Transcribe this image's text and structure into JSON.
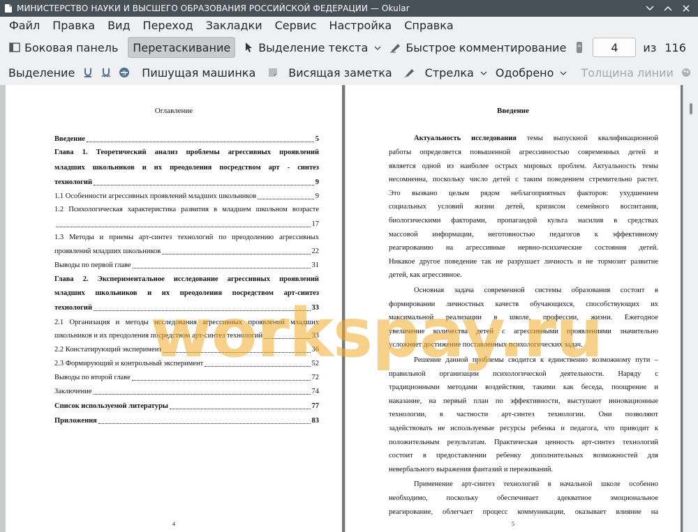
{
  "window": {
    "title": "МИНИСТЕРСТВО НАУКИ И ВЫСШЕГО ОБРАЗОВАНИЯ РОССИЙСКОЙ ФЕДЕРАЦИИ  — Okular",
    "controls": [
      "chevron-down-icon",
      "chevron-up-icon",
      "close-icon"
    ]
  },
  "menu": [
    "Файл",
    "Правка",
    "Вид",
    "Переход",
    "Закладки",
    "Сервис",
    "Настройка",
    "Справка"
  ],
  "toolbar1": {
    "sidebar": "Боковая панель",
    "drag": "Перетаскивание",
    "text_select": "Выделение текста",
    "quick_comment": "Быстрое комментирование",
    "page_value": "4",
    "of_label": "из",
    "total_pages": "116"
  },
  "toolbar2": {
    "highlight": "Выделение",
    "typewriter": "Пишущая машинка",
    "note": "Висящая заметка",
    "arrow": "Стрелка",
    "approved": "Одобрено",
    "line_width": "Толщина линии"
  },
  "left_page": {
    "heading": "Оглавление",
    "page_number": "4",
    "toc": [
      {
        "text": "Введение",
        "page": "5"
      },
      {
        "line1": "Глава 1. Теоретический анализ проблемы агрессивных проявлений",
        "line2": "младших школьников и их преодоления посредством арт - синтез",
        "text": "технологий",
        "page": "9"
      },
      {
        "text": "1.1 Особенности агрессивных проявлений младших школьников",
        "page": "9"
      },
      {
        "line1": "1.2 Психологическая характеристика развития в младшем школьном возрасте",
        "text": "",
        "page": "17"
      },
      {
        "line1": "1.3 Методы и приемы арт-синтез технологий  по преодолению агрессивных",
        "text": "проявлений младших школьников",
        "page": "22"
      },
      {
        "text": "Выводы по первой главе",
        "page": "31"
      },
      {
        "line1": "Глава 2. Экспериментальное исследование агрессивных проявлений",
        "line2": "младших школьников и их преодоления посредством арт-синтез",
        "text": "технологий",
        "page": "33"
      },
      {
        "line1": "2.1 Организация и методы исследования агрессивных проявлений младших",
        "text": "школьников и их преодоления посредством арт-синтез технологий",
        "page": "33"
      },
      {
        "text": "2.2 Констатирующий эксперимент",
        "page": "36"
      },
      {
        "text": "2.3 Формирующий и контрольный эксперимент",
        "page": "52"
      },
      {
        "text": "Выводы по второй главе",
        "page": "72"
      },
      {
        "text": "Заключение",
        "page": "74"
      },
      {
        "text": "Список используемой литературы",
        "page": "77"
      },
      {
        "text": "Приложения",
        "page": "83"
      }
    ]
  },
  "right_page": {
    "heading": "Введение",
    "page_number": "5",
    "p1_lead": "Актуальность исследования",
    "p1_first_rest": " темы выпускной квалификационной",
    "lines": [
      "работы определяется повышенной агрессивностью современных детей и",
      "является одной из наиболее острых мировых проблем. Актуальность темы",
      "несомненна, поскольку число детей с таким поведением стремительно растет.",
      "Это вызвано целым рядом неблагоприятных факторов: ухудшением",
      "социальных условий жизни детей, кризисом семейного воспитания,",
      "биологическими факторами, пропагандой культа насилия в средствах",
      "массовой информации, неготовностью педагогов к эффективному",
      "реагированию на агрессивные нервно-психические состояния детей.",
      "Никакое другое поведение так не разрушает личность и не тормозит развитие",
      "детей, как агрессивное.",
      "Основная задача современной системы образования состоит в",
      "формировании личностных качеств обучающихся, способствующих их",
      "максимальной реализации   в школе, профессии, жизни.   Ежегодное",
      "увеличение количества детей с агрессивными проявлениями значительно",
      "усложняет достижение поставленных психологических задач.",
      "Решение данной проблемы сводится к единственно возможному пути –",
      "правильной организации психологической деятельности. Наряду с",
      "традиционными методами воздействия, такими как беседа, поощрение и",
      "наказание, на первый план по эффективности, выступают инновационные",
      "технологии,   в частности арт-синтез технологии. Они позволяют",
      "задействовать не используемые ресурсы ребенка и педагога, что приводит к",
      "положительным результатам. Практическая ценность арт-синтез технологий",
      "состоит в предоставлении ребенку дополнительных возможностей для",
      "невербального выражения фантазий и переживаний.",
      "Применение арт-синтез технологий в начальной школе особенно",
      "необходимо, поскольку обеспечивает адекватное эмоциональное",
      "реагирование, облегчает процесс коммуникации, оказывает влияние на"
    ]
  },
  "watermark": "workspay.ru"
}
